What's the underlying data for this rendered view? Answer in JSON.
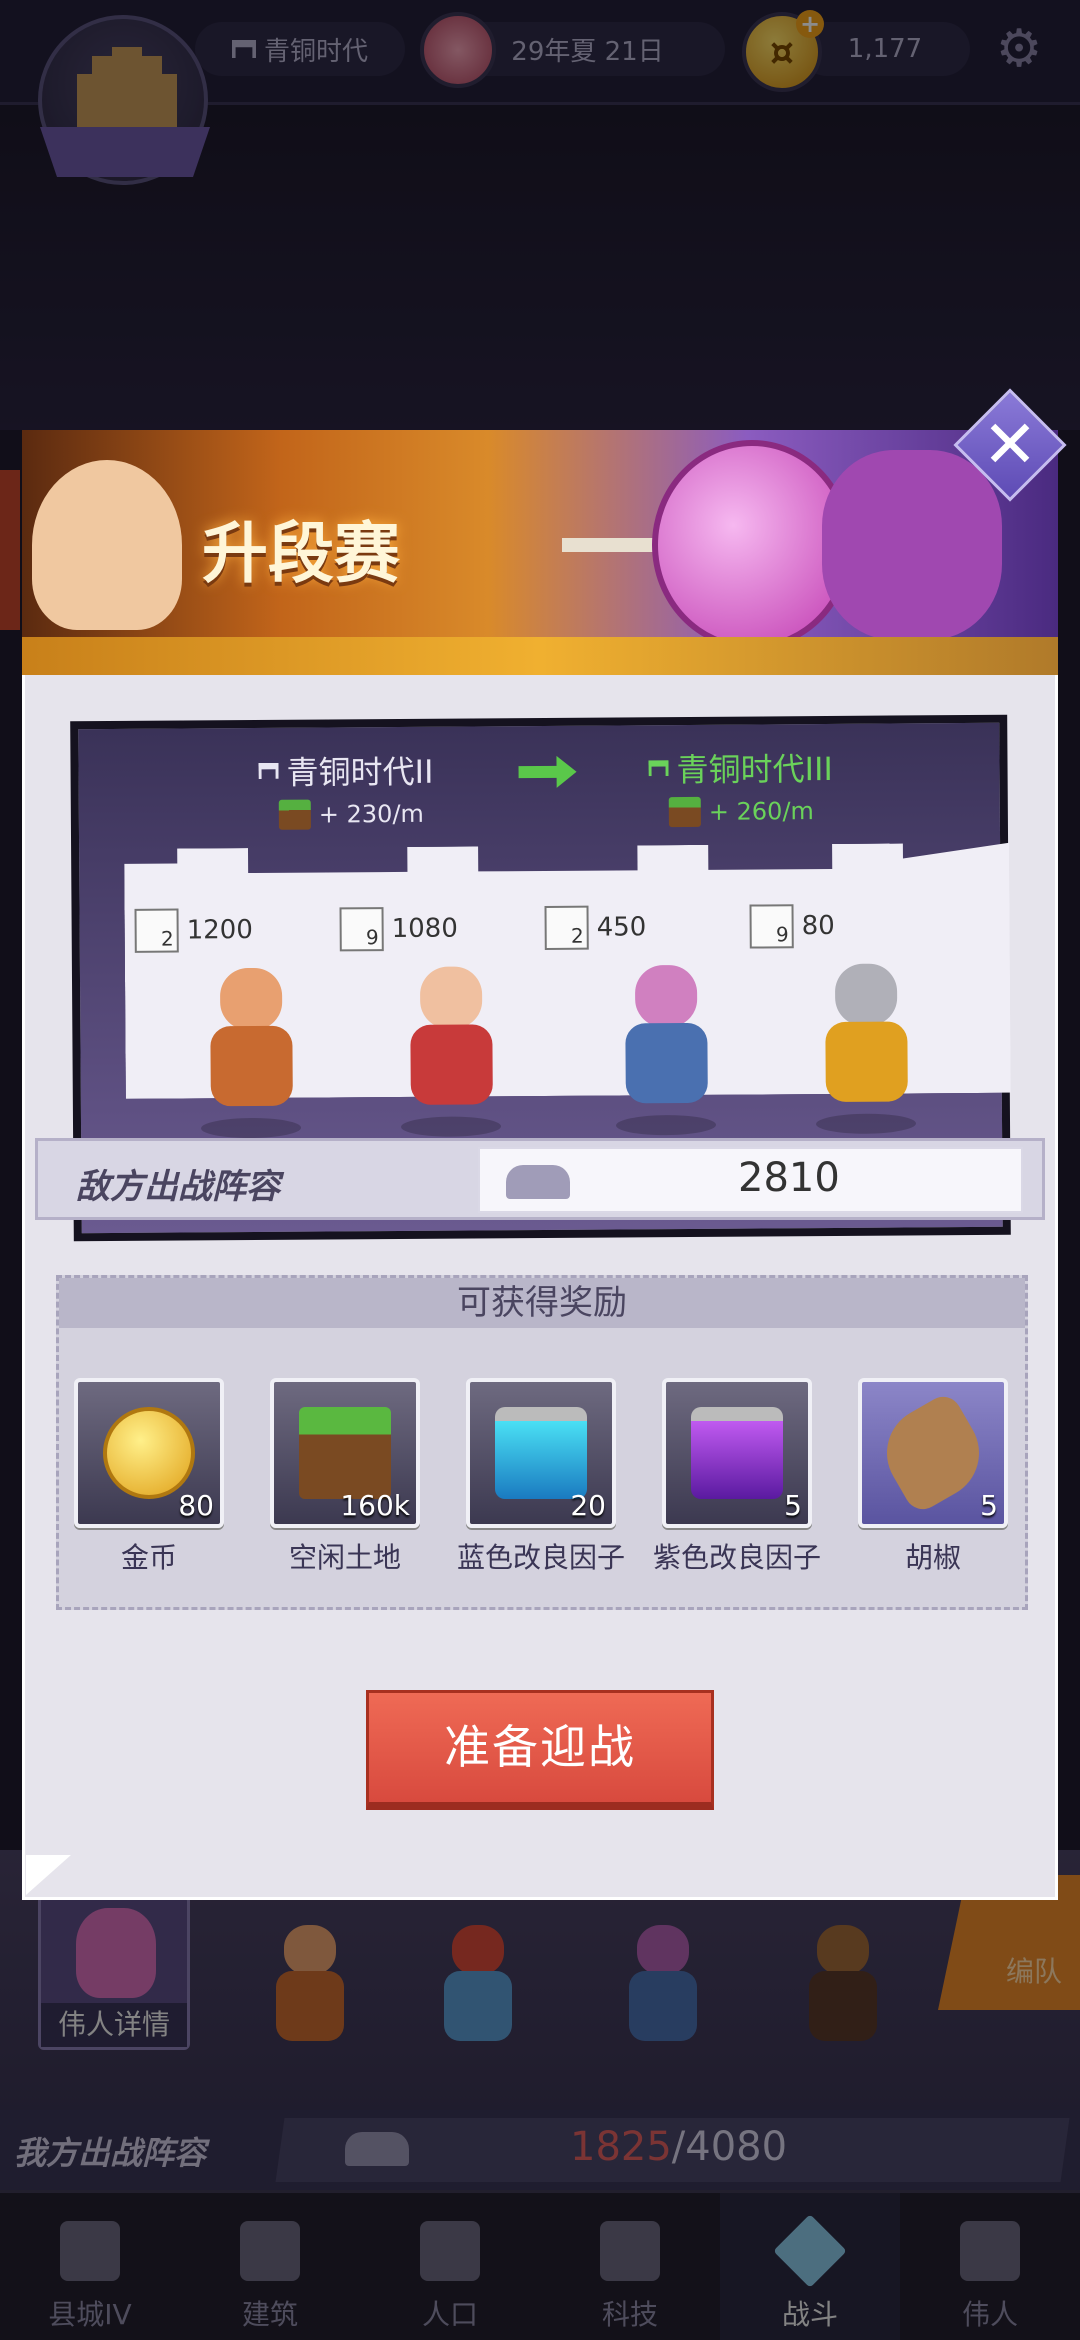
{
  "topbar": {
    "era": "青铜时代",
    "date": "29年夏 21日",
    "gold": "1,177"
  },
  "modal": {
    "banner_title": "升段赛",
    "current_tier": "青铜时代II",
    "current_rate": "+ 230/m",
    "next_tier": "青铜时代III",
    "next_rate": "+ 260/m",
    "enemy_units": [
      {
        "level": "2",
        "count": "1200",
        "icon": "spear-icon",
        "head": "#e8a070",
        "body": "#c86a30"
      },
      {
        "level": "9",
        "count": "1080",
        "icon": "musket-icon",
        "head": "#f0c0a0",
        "body": "#c83a3a"
      },
      {
        "level": "2",
        "count": "450",
        "icon": "sword-icon",
        "head": "#d080c0",
        "body": "#4a70b0"
      },
      {
        "level": "9",
        "count": "80",
        "icon": "cavalry-icon",
        "head": "#b0b0b8",
        "body": "#e0a020"
      }
    ],
    "enemy_lineup_label": "敌方出战阵容",
    "enemy_power": "2810",
    "rewards_title": "可获得奖励",
    "rewards": [
      {
        "name": "金币",
        "count": "80",
        "icon": "gold-coin-icon"
      },
      {
        "name": "空闲土地",
        "count": "160k",
        "icon": "land-icon"
      },
      {
        "name": "蓝色改良因子",
        "count": "20",
        "icon": "blue-vial-icon"
      },
      {
        "name": "紫色改良因子",
        "count": "5",
        "icon": "purple-vial-icon"
      },
      {
        "name": "胡椒",
        "count": "5",
        "icon": "pepper-icon"
      }
    ],
    "battle_button": "准备迎战"
  },
  "background": {
    "hero_details": "伟人详情",
    "team_button": "编队",
    "my_lineup_label": "我方出战阵容",
    "my_power_current": "1825",
    "my_power_max": "/4080"
  },
  "nav": [
    {
      "label": "县城IV",
      "icon": "town-icon"
    },
    {
      "label": "建筑",
      "icon": "building-icon"
    },
    {
      "label": "人口",
      "icon": "population-icon"
    },
    {
      "label": "科技",
      "icon": "tech-book-icon"
    },
    {
      "label": "战斗",
      "icon": "battle-icon",
      "active": true
    },
    {
      "label": "伟人",
      "icon": "great-people-icon"
    }
  ],
  "colors": {
    "accent_green": "#6ad25a",
    "battle_button": "#e05a48",
    "my_power_current": "#e06060"
  }
}
